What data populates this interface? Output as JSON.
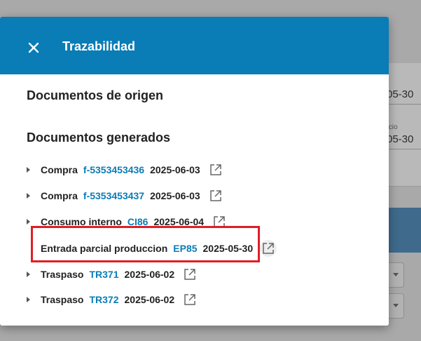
{
  "background": {
    "field_1_value": "05-30",
    "field_2_label": "ício",
    "field_2_value": "05-30"
  },
  "dialog": {
    "title": "Trazabilidad",
    "close_icon": "close-icon",
    "sections": {
      "origin_title": "Documentos de origen",
      "generated_title": "Documentos generados"
    },
    "generated_documents": [
      {
        "type": "Compra",
        "code": "f-5353453436",
        "date": "2025-06-03",
        "expandable": true
      },
      {
        "type": "Compra",
        "code": "f-5353453437",
        "date": "2025-06-03",
        "expandable": true
      },
      {
        "type": "Consumo interno",
        "code": "CI86",
        "date": "2025-06-04",
        "expandable": true
      },
      {
        "type": "Entrada parcial produccion",
        "code": "EP85",
        "date": "2025-05-30",
        "expandable": false,
        "highlighted": true
      },
      {
        "type": "Traspaso",
        "code": "TR371",
        "date": "2025-06-02",
        "expandable": true
      },
      {
        "type": "Traspaso",
        "code": "TR372",
        "date": "2025-06-02",
        "expandable": true
      }
    ]
  },
  "colors": {
    "header": "#0a7cb6",
    "link": "#0a7cb6",
    "highlight": "#e01e25"
  }
}
